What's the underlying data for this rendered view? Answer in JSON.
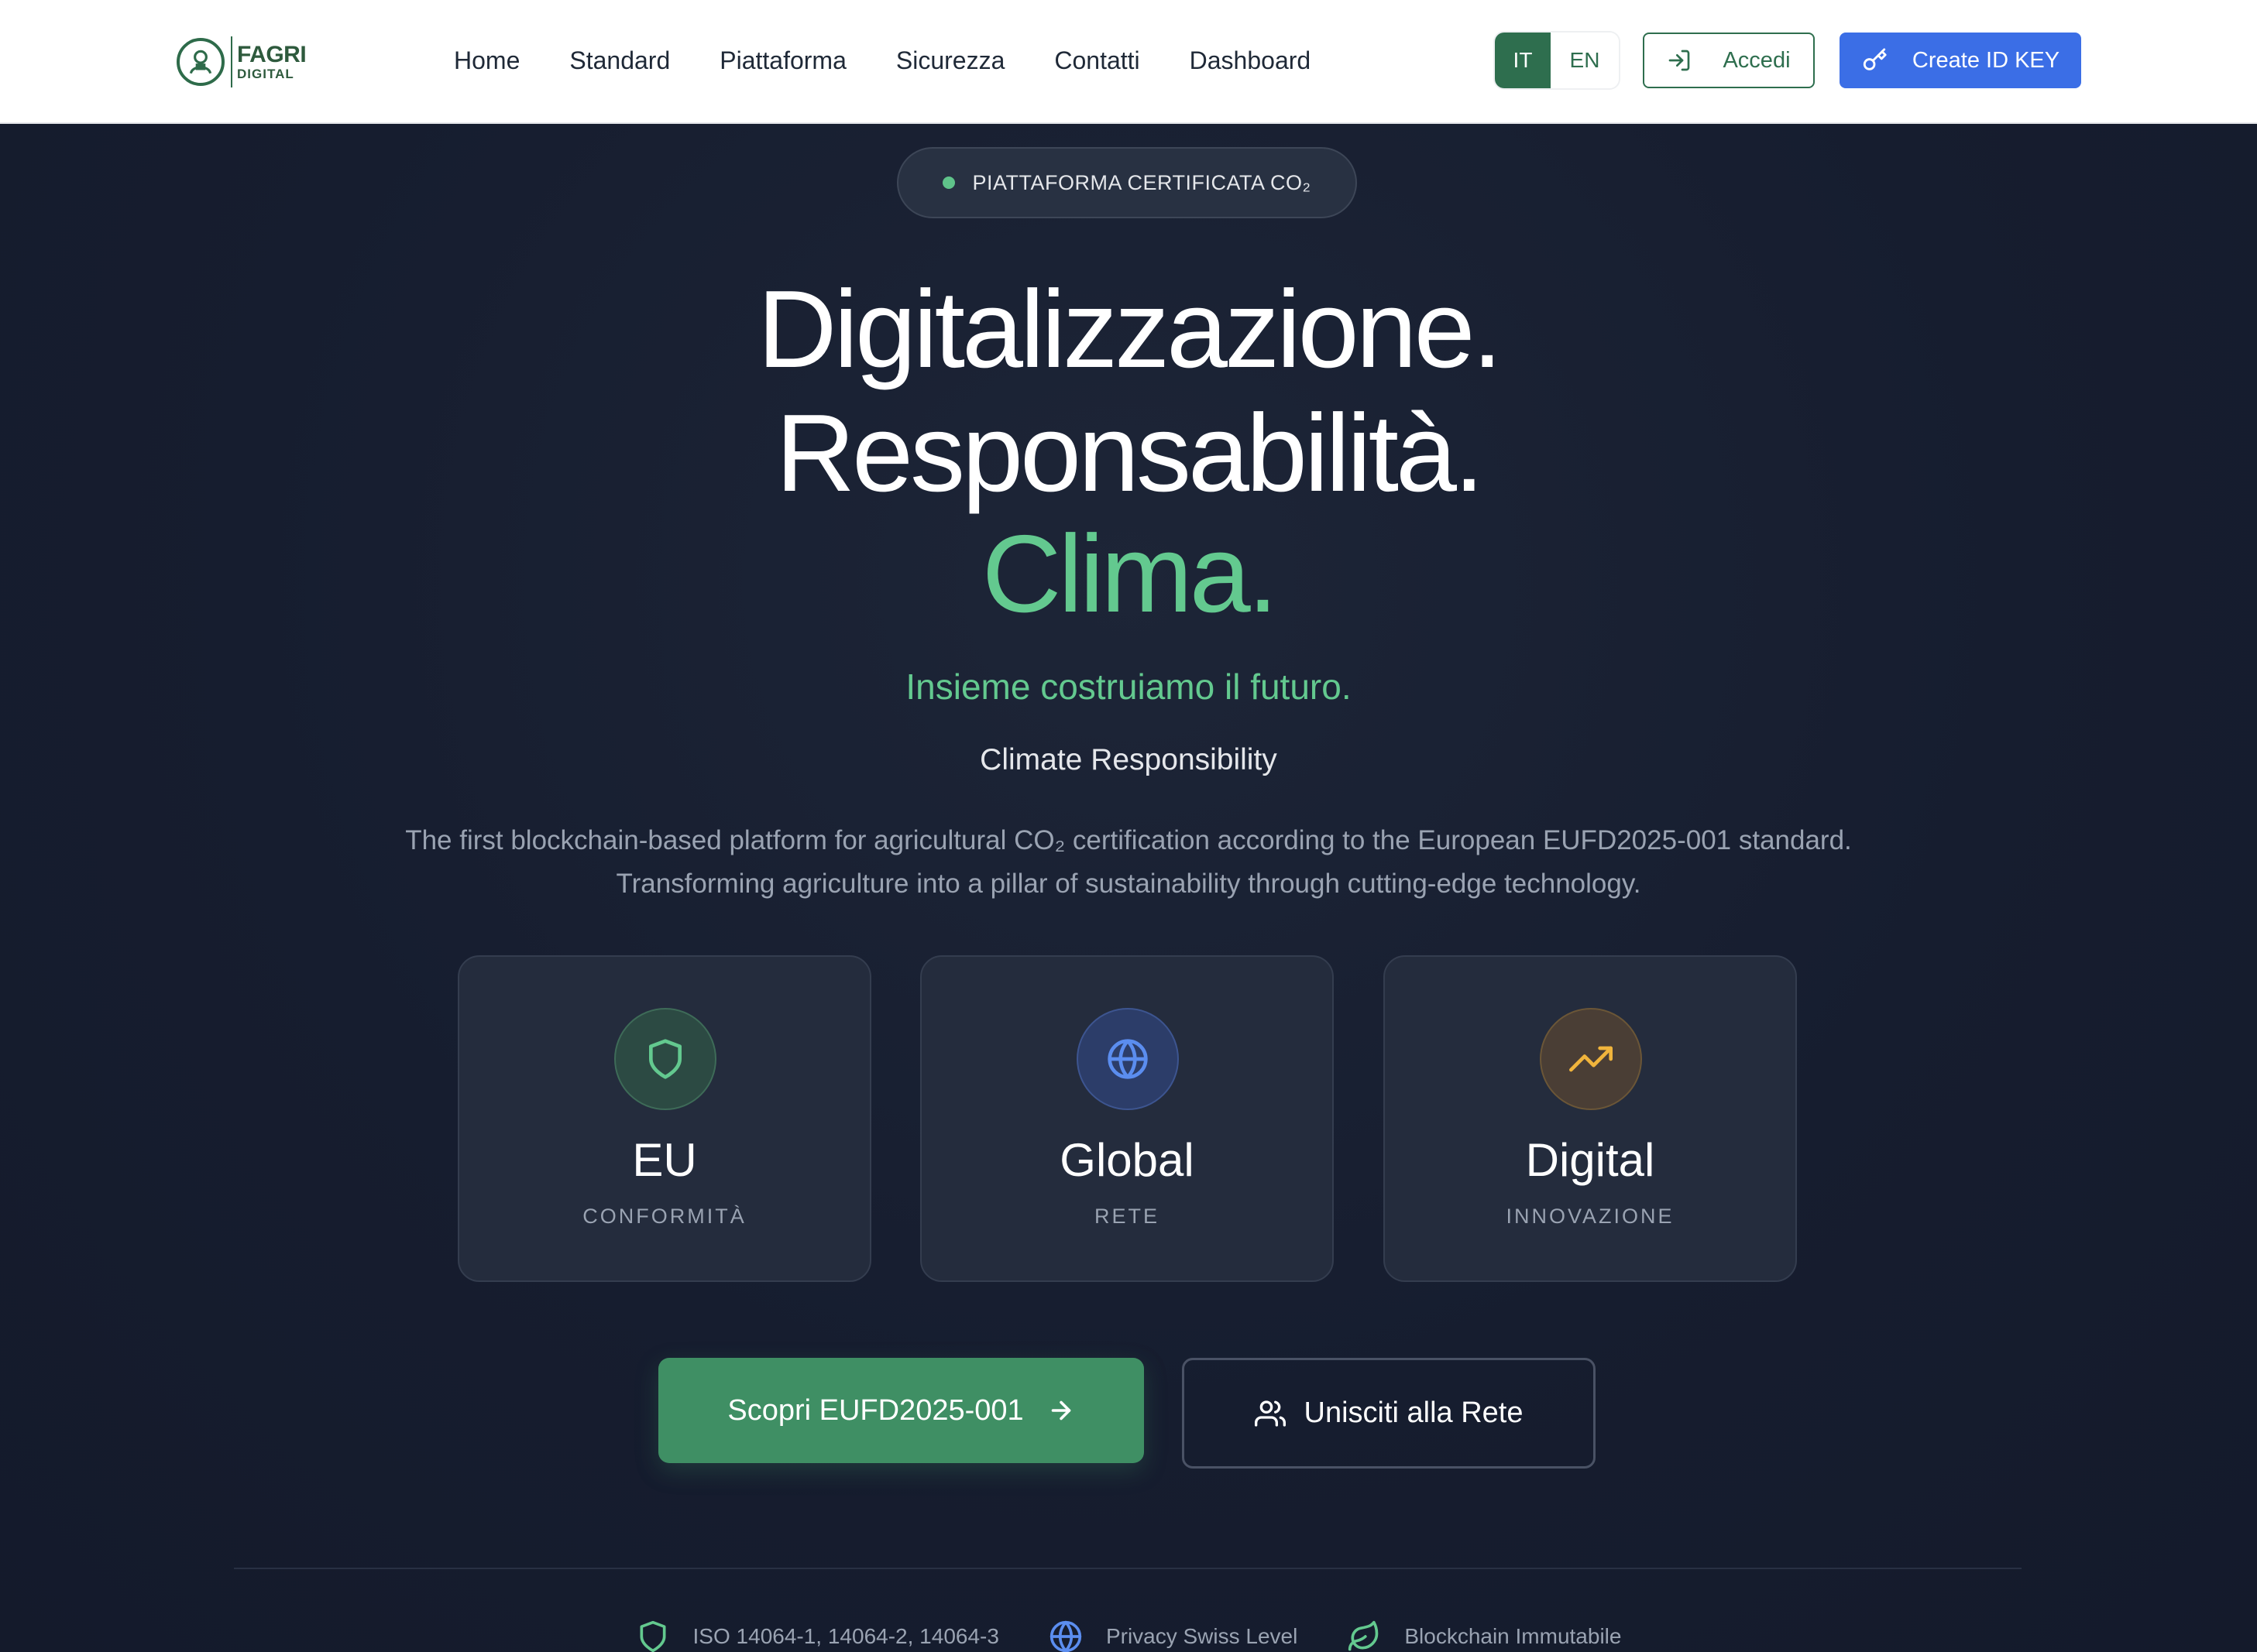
{
  "brand": {
    "logo_line1": "FAGRI",
    "logo_line2": "DIGITAL",
    "accent": "#63c98f",
    "primary_green": "#2e6e4e",
    "primary_blue": "#3b6ee6"
  },
  "nav": {
    "items": [
      "Home",
      "Standard",
      "Piattaforma",
      "Sicurezza",
      "Contatti",
      "Dashboard"
    ]
  },
  "header": {
    "lang_it": "IT",
    "lang_en": "EN",
    "lang_selected": "IT",
    "login_label": "Accedi",
    "login_icon": "log-in-icon",
    "create_label": "Create ID KEY",
    "create_icon": "key-icon"
  },
  "hero": {
    "badge": "PIATTAFORMA CERTIFICATA CO₂",
    "headline_1": "Digitalizzazione.",
    "headline_2": "Responsabilità.",
    "headline_3": "Clima.",
    "tagline": "Insieme costruiamo il futuro.",
    "subtitle": "Climate Responsibility",
    "description_1": "The first blockchain-based platform for agricultural CO₂ certification according to the European EUFD2025-001 standard.",
    "description_2": "Transforming agriculture into a pillar of sustainability through cutting-edge technology."
  },
  "cards": [
    {
      "title": "EU",
      "subtitle": "CONFORMITÀ",
      "icon": "shield-icon",
      "color": "#63c98f"
    },
    {
      "title": "Global",
      "subtitle": "RETE",
      "icon": "globe-icon",
      "color": "#5b8def"
    },
    {
      "title": "Digital",
      "subtitle": "INNOVAZIONE",
      "icon": "trending-up-icon",
      "color": "#f0b43c"
    }
  ],
  "cta": {
    "primary_label": "Scopri EUFD2025-001",
    "secondary_label": "Unisciti alla Rete"
  },
  "features": [
    {
      "label": "ISO 14064-1, 14064-2, 14064-3",
      "icon": "shield-icon"
    },
    {
      "label": "Privacy Swiss Level",
      "icon": "globe-icon"
    },
    {
      "label": "Blockchain Immutabile",
      "icon": "leaf-icon"
    }
  ]
}
